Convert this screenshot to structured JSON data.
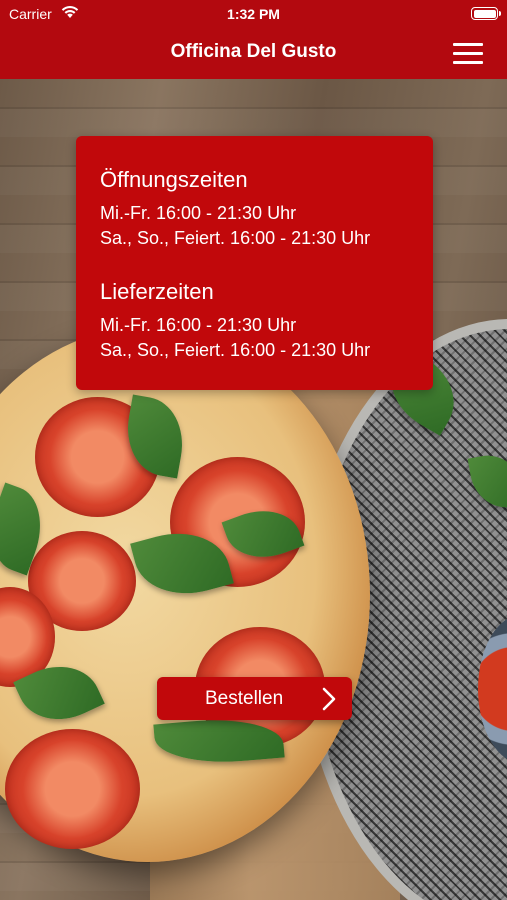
{
  "status_bar": {
    "carrier": "Carrier",
    "time": "1:32 PM",
    "icons": [
      "wifi-icon",
      "battery-icon"
    ]
  },
  "nav": {
    "title": "Officina Del Gusto",
    "menu_icon": "hamburger-menu-icon"
  },
  "colors": {
    "bar_red": "#b3090f",
    "card_red": "#c1080b",
    "text": "#ffffff"
  },
  "hours": {
    "opening_title": "Öffnungszeiten",
    "opening_lines": [
      "Mi.-Fr. 16:00 - 21:30 Uhr",
      "Sa., So., Feiert. 16:00 - 21:30 Uhr"
    ],
    "delivery_title": "Lieferzeiten",
    "delivery_lines": [
      "Mi.-Fr. 16:00 - 21:30 Uhr",
      "Sa., So., Feiert. 16:00 - 21:30 Uhr"
    ]
  },
  "order_button": {
    "label": "Bestellen",
    "icon": "chevron-right-icon"
  }
}
